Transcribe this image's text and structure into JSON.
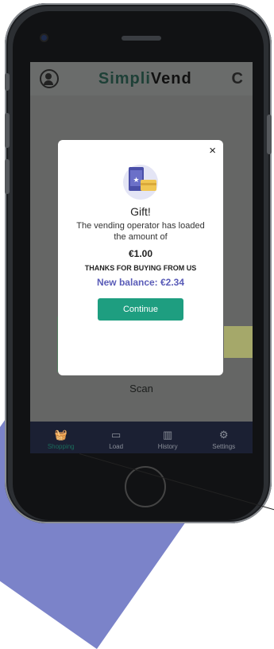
{
  "app": {
    "brand_left": "Simpli",
    "brand_right": "Vend",
    "brand_color": "#1e4037"
  },
  "header": {
    "profile_icon": "profile-icon",
    "refresh_icon": "refresh-icon",
    "refresh_glyph": "C"
  },
  "background": {
    "scan_label": "Scan"
  },
  "modal": {
    "close_glyph": "×",
    "title": "Gift!",
    "message": "The vending operator has loaded the amount of",
    "amount": "€1.00",
    "thanks": "THANKS FOR BUYING FROM US",
    "balance": "New balance: €2.34",
    "continue_label": "Continue",
    "accent": "#5a5cb8",
    "button_color": "#1e9e80"
  },
  "tabs": [
    {
      "label": "Shopping",
      "icon": "basket-icon",
      "glyph": "🧺",
      "active": true
    },
    {
      "label": "Load",
      "icon": "card-icon",
      "glyph": "▭",
      "active": false
    },
    {
      "label": "History",
      "icon": "chart-icon",
      "glyph": "▥",
      "active": false
    },
    {
      "label": "Settings",
      "icon": "gear-icon",
      "glyph": "⚙",
      "active": false
    }
  ]
}
